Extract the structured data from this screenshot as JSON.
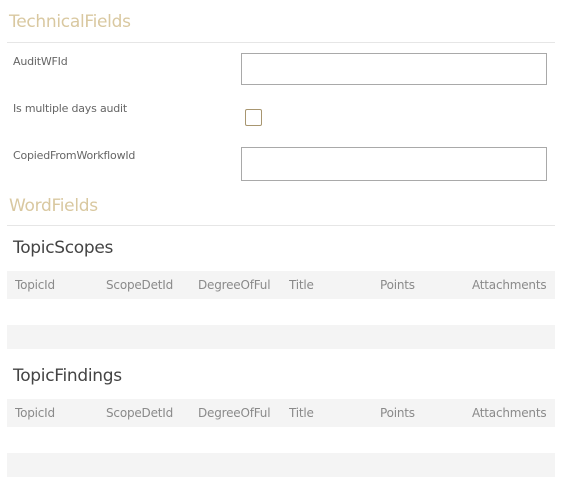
{
  "technical_fields": {
    "title": "TechnicalFields",
    "audit_wf_id": {
      "label": "AuditWFId",
      "value": ""
    },
    "multiple_days": {
      "label": "Is multiple days audit",
      "checked": false
    },
    "copied_from_workflow": {
      "label": "CopiedFromWorkflowId",
      "value": ""
    }
  },
  "word_fields": {
    "title": "WordFields"
  },
  "topic_scopes": {
    "title": "TopicScopes",
    "columns": [
      "TopicId",
      "ScopeDetId",
      "DegreeOfFul",
      "Title",
      "Points",
      "Attachments"
    ]
  },
  "topic_findings": {
    "title": "TopicFindings",
    "columns": [
      "TopicId",
      "ScopeDetId",
      "DegreeOfFul",
      "Title",
      "Points",
      "Attachments"
    ]
  }
}
